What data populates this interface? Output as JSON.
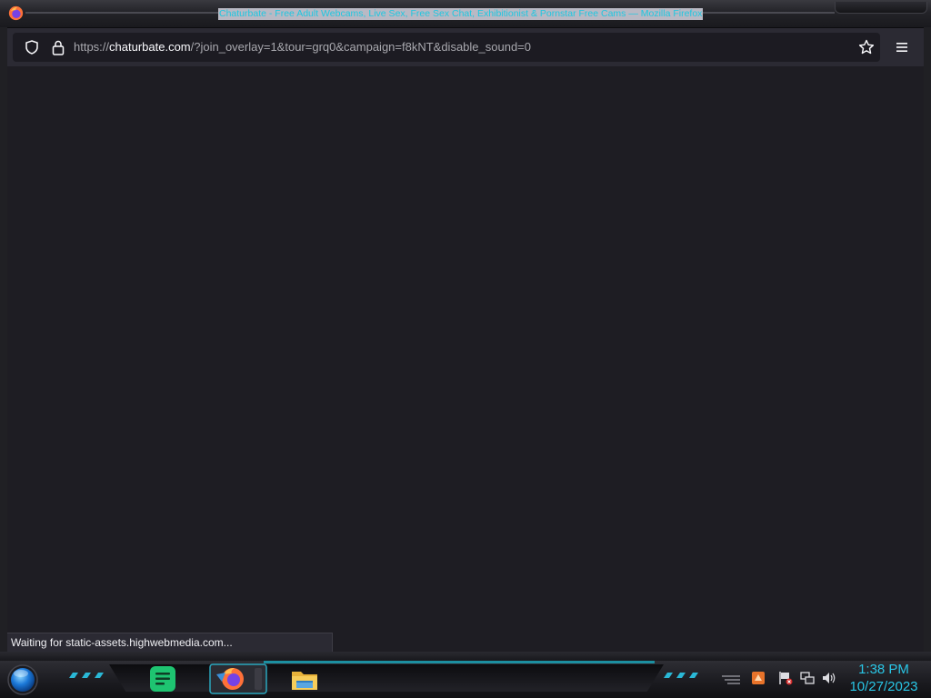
{
  "window": {
    "title": "Chaturbate - Free Adult Webcams, Live Sex, Free Sex Chat, Exhibitionist & Pornstar Free Cams — Mozilla Firefox"
  },
  "browser": {
    "url_prefix": "https://",
    "url_host": "chaturbate.com",
    "url_path": "/?join_overlay=1&tour=grq0&campaign=f8kNT&disable_sound=0",
    "status": "Waiting for static-assets.highwebmedia.com..."
  },
  "taskbar": {
    "apps": [
      "notes-app",
      "firefox",
      "file-explorer"
    ],
    "active_app": "firefox"
  },
  "clock": {
    "time": "1:38 PM",
    "date": "10/27/2023"
  },
  "colors": {
    "title_text": "#1fc7e0",
    "clock_text": "#29c6e6",
    "page_background": "#1e1d23",
    "urlbar_background": "#1c1b22",
    "toolbar_background": "#2b2a33"
  }
}
